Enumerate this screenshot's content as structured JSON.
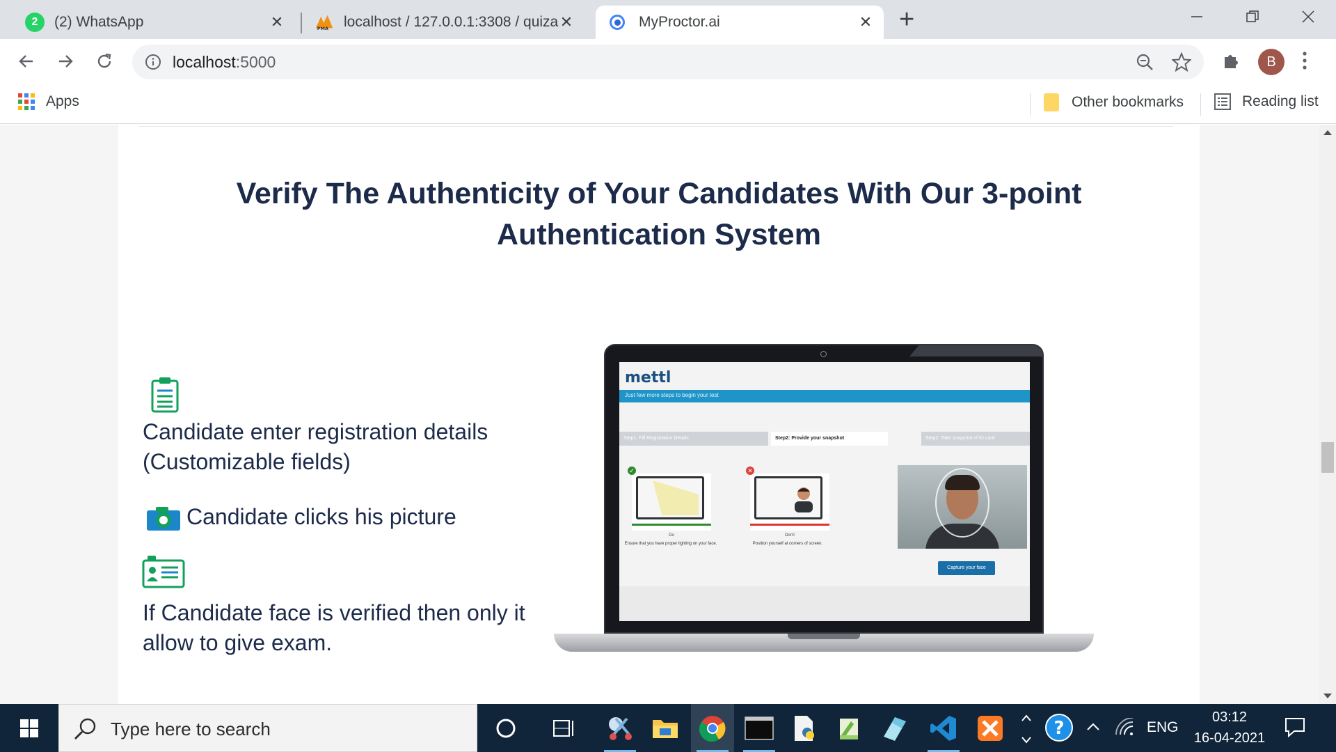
{
  "browser": {
    "tabs": [
      {
        "title": "(2) WhatsApp",
        "badge": "2"
      },
      {
        "title": "localhost / 127.0.0.1:3308 / quiza"
      },
      {
        "title": "MyProctor.ai"
      }
    ],
    "url_host": "localhost",
    "url_port": ":5000",
    "profile_initial": "B",
    "bookmarks": {
      "apps": "Apps",
      "other": "Other bookmarks",
      "reading_list": "Reading list"
    }
  },
  "page": {
    "headline_line1": "Verify The Authenticity of Your Candidates With Our 3-point",
    "headline_line2": "Authentication System",
    "features": [
      {
        "icon": "clipboard-icon",
        "line1": "Candidate enter registration details",
        "line2": "(Customizable fields)"
      },
      {
        "icon": "camera-icon",
        "line1": "Candidate clicks his picture"
      },
      {
        "icon": "id-card-icon",
        "line1": "If Candidate face is verified then only it",
        "line2": "allow to give exam."
      }
    ],
    "laptop_screen": {
      "logo": "mettl",
      "banner": "Just few more steps to begin your test",
      "steps": [
        "Step1: Fill Registration Details",
        "Step2: Provide your snapshot",
        "Step2: Take snapshot of ID card"
      ],
      "do_title": "Do",
      "do_text": "Ensure that you have proper lighting on your face.",
      "dont_title": "Don't",
      "dont_text": "Position yourself at corners of screen.",
      "capture_button": "Capture your face"
    }
  },
  "taskbar": {
    "search_placeholder": "Type here to search",
    "language": "ENG",
    "time": "03:12",
    "date": "16-04-2021"
  },
  "colors": {
    "accent_blue": "#1f94c9",
    "headline": "#1d2b4a",
    "icon_green": "#12a05a",
    "taskbar": "#10253a"
  }
}
